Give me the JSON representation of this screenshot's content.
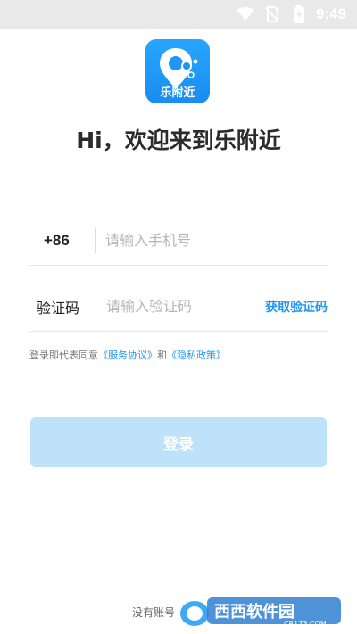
{
  "status_bar": {
    "time": "9:49",
    "icons": [
      "wifi-icon",
      "no-sim-icon",
      "battery-charging-icon"
    ]
  },
  "logo": {
    "text": "乐附近",
    "color": "#1e96f6"
  },
  "headline": "Hi，欢迎来到乐附近",
  "phone": {
    "country_code": "+86",
    "placeholder": "请输入手机号"
  },
  "verification": {
    "label": "验证码",
    "placeholder": "请输入验证码",
    "get_code_label": "获取验证码"
  },
  "agreement": {
    "prefix": "登录即代表同意",
    "service_link": "《服务协议》",
    "and": "和",
    "privacy_link": "《隐私政策》"
  },
  "login_button": {
    "label": "登录",
    "color": "#bfe2fb"
  },
  "bottom": {
    "text": "没有账号"
  },
  "watermark": {
    "text": "西西软件园",
    "url_text": "CR173.COM"
  },
  "accent_color": "#2196f3"
}
